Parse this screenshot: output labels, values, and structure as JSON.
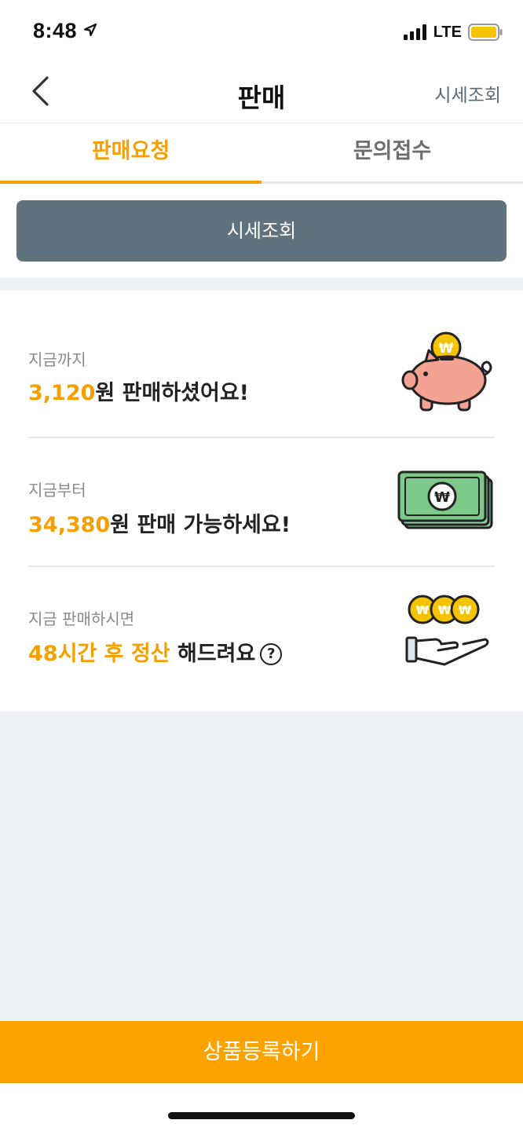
{
  "status_bar": {
    "time": "8:48",
    "network": "LTE",
    "battery_color": "#f5c400"
  },
  "nav": {
    "title": "판매",
    "action_label": "시세조회",
    "back_icon": "chevron-left-icon"
  },
  "tabs": [
    {
      "label": "판매요청",
      "active": true
    },
    {
      "label": "문의접수",
      "active": false
    }
  ],
  "quote_button": {
    "label": "시세조회"
  },
  "info": {
    "sold": {
      "label": "지금까지",
      "amount": "3,120",
      "suffix": "원 판매하셨어요!",
      "icon": "piggy-bank-icon"
    },
    "available": {
      "label": "지금부터",
      "amount": "34,380",
      "suffix": "원 판매 가능하세요!",
      "icon": "cash-stack-icon"
    },
    "settlement": {
      "label": "지금 판매하시면",
      "highlight": "48시간 후 정산",
      "suffix": " 해드려요",
      "help": "?",
      "icon": "coins-hand-icon"
    }
  },
  "register_button": {
    "label": "상품등록하기"
  },
  "colors": {
    "accent": "#f5a000",
    "button_gray": "#5f727e",
    "register_orange": "#fda301",
    "background": "#f0f1f5"
  }
}
